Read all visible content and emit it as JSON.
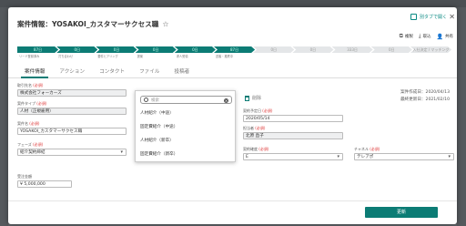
{
  "title": "案件情報：YOSAKOI_カスタマーサクセス職",
  "open_in_new_tab": "別タブで開く",
  "actions": [
    {
      "icon": "copy-icon",
      "label": "複製"
    },
    {
      "icon": "pin-icon",
      "label": "取込"
    },
    {
      "icon": "user-icon",
      "label": "共有"
    }
  ],
  "stages": [
    {
      "label": "87日",
      "sub": "リード登録済み",
      "state": "done"
    },
    {
      "label": "0日",
      "sub": "打ち合わせ",
      "state": "done"
    },
    {
      "label": "0日",
      "sub": "要件ヒアリング",
      "state": "done"
    },
    {
      "label": "0日",
      "sub": "提案",
      "state": "done"
    },
    {
      "label": "0日",
      "sub": "求人受領",
      "state": "done"
    },
    {
      "label": "87日",
      "sub": "送客・推薦中",
      "state": "current"
    },
    {
      "label": "0日",
      "sub": "",
      "state": "pending"
    },
    {
      "label": "0日",
      "sub": "",
      "state": "pending"
    },
    {
      "label": "333日",
      "sub": "",
      "state": "pending"
    },
    {
      "label": "0日",
      "sub": "",
      "state": "pending"
    },
    {
      "label": "入社決定 / マッチング",
      "sub": "",
      "state": "pending"
    }
  ],
  "tabs": [
    "案件情報",
    "アクション",
    "コンタクト",
    "ファイル",
    "投稿者"
  ],
  "fields": {
    "company": {
      "label": "取引先名",
      "value": "株式会社フォーカーズ"
    },
    "case_type": {
      "label": "案件タイプ",
      "value": "人材（正規雇用）"
    },
    "case_name": {
      "label": "案件名",
      "value": "YOSAKOI_カスタマーサクセス職"
    },
    "phase": {
      "label": "フェーズ",
      "value": "紹介契約締結"
    },
    "product": {
      "label": "商品タイプ",
      "value": "人材紹介（中途）"
    },
    "order_date": {
      "label": "契約予定日",
      "value": "2020/05/14"
    },
    "owner": {
      "label": "担当者",
      "value": "北原 直子"
    },
    "contract_status": {
      "label": "契約確度",
      "value": "E"
    },
    "channel": {
      "label": "チャネル",
      "value": "テレアポ"
    },
    "amount": {
      "label": "受注金額",
      "value": "¥ 5,000,000"
    }
  },
  "delete_label": "削除",
  "created_date": "案件作成日：2020/04/13",
  "updated_date": "最終更新日：2021/02/10",
  "dropdown": {
    "search_placeholder": "検索",
    "options": [
      "人材紹介（中途）",
      "固定費紹介（中途）",
      "人材紹介（新卒）",
      "固定費紹介（新卒）"
    ]
  },
  "submit_label": "更新"
}
